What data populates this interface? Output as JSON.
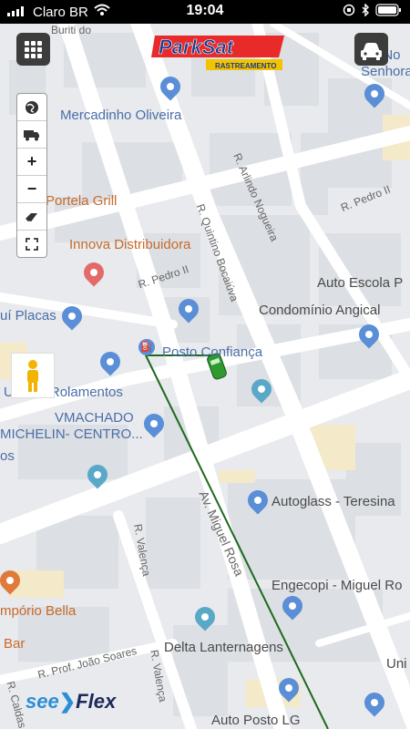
{
  "status_bar": {
    "carrier": "Claro BR",
    "time": "19:04"
  },
  "header": {
    "logo_text": "ParkSat",
    "logo_sub": "RASTREAMENTO"
  },
  "map_controls": [
    {
      "icon": "globe-icon"
    },
    {
      "icon": "truck-icon"
    },
    {
      "icon": "zoom-in-icon",
      "glyph": "+"
    },
    {
      "icon": "zoom-out-icon",
      "glyph": "−"
    },
    {
      "icon": "eraser-icon"
    },
    {
      "icon": "fullscreen-icon"
    }
  ],
  "pois": {
    "mercadinho": "Mercadinho Oliveira",
    "portela": "Portela Grill",
    "innova": "Innova Distribuidora",
    "auto_escola": "Auto Escola P",
    "condominio": "Condomínio Angical",
    "placas": "uí Placas",
    "posto_confianca": "Posto Confiança",
    "unidos": "Unidos Rolamentos",
    "vmachado": "VMACHADO",
    "michelin": "MICHELIN- CENTRO...",
    "os": "os",
    "autoglass": "Autoglass - Teresina",
    "engecopi": "Engecopi - Miguel Ro",
    "emporio": "mpório Bella",
    "bar": "Bar",
    "delta": "Delta Lanternagens",
    "auto_posto": "Auto Posto LG",
    "uni": "Uni",
    "senhora_top": "I No",
    "senhora": "Senhora"
  },
  "streets": {
    "buriti": "Buriti do",
    "arlindo": "R. Arlindo Nogueira",
    "pedro2_right": "R. Pedro II",
    "quintino": "R. Quintino Bocaiúva",
    "pedro2_left": "R. Pedro II",
    "miguel_rosa": "Av. Miguel Rosa",
    "valenca_1": "R. Valença",
    "valenca_2": "R. Valença",
    "joao_soares": "R. Prof. João Soares",
    "caldas": "R. Caldas"
  },
  "footer": {
    "brand_see": "see",
    "brand_flex": "Flex"
  },
  "colors": {
    "route": "#1d6a1d",
    "vehicle": "#2f9a2f",
    "poi_blue": "#5a8ed6",
    "poi_orange": "#e07a3a",
    "poi_pink": "#e46a6a",
    "poi_teal": "#5aa8c8"
  }
}
